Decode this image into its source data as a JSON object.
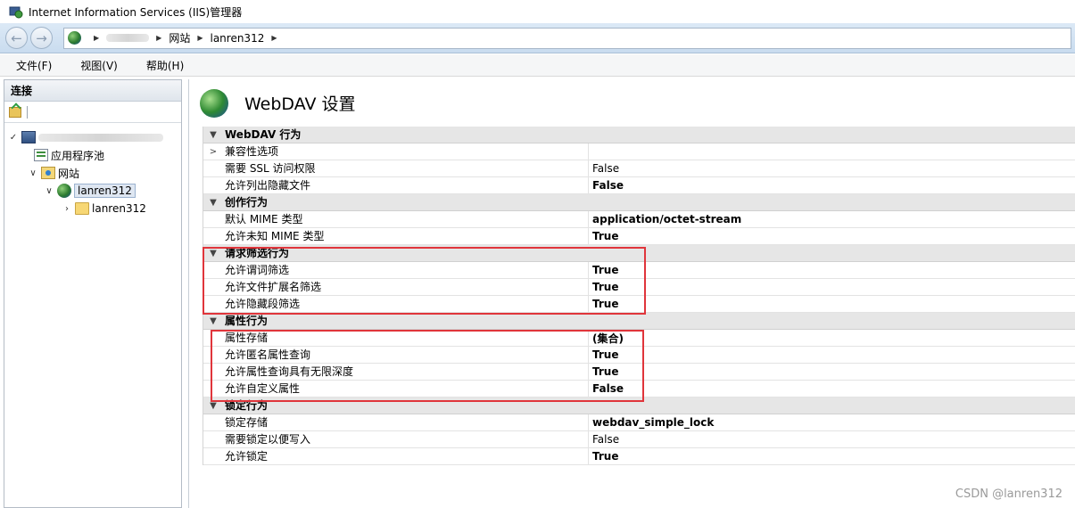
{
  "window": {
    "title": "Internet Information Services (IIS)管理器"
  },
  "address": {
    "crumbs": [
      "网站",
      "lanren312"
    ]
  },
  "menu": [
    "文件(F)",
    "视图(V)",
    "帮助(H)"
  ],
  "connections": {
    "header": "连接",
    "tree": {
      "app_pools": "应用程序池",
      "sites": "网站",
      "site": "lanren312",
      "folder": "lanren312"
    }
  },
  "page": {
    "title": "WebDAV 设置"
  },
  "properties": [
    {
      "type": "section",
      "label": "WebDAV 行为",
      "expander": "▼"
    },
    {
      "type": "row",
      "label": "兼容性选项",
      "value": "",
      "expander": ">"
    },
    {
      "type": "row",
      "label": "需要 SSL 访问权限",
      "value": "False",
      "bold": false
    },
    {
      "type": "row",
      "label": "允许列出隐藏文件",
      "value": "False",
      "bold": true
    },
    {
      "type": "section",
      "label": "创作行为",
      "expander": "▼"
    },
    {
      "type": "row",
      "label": "默认 MIME 类型",
      "value": "application/octet-stream",
      "bold": true
    },
    {
      "type": "row",
      "label": "允许未知 MIME 类型",
      "value": "True",
      "bold": true
    },
    {
      "type": "section",
      "label": "请求筛选行为",
      "expander": "▼"
    },
    {
      "type": "row",
      "label": "允许谓词筛选",
      "value": "True",
      "bold": true
    },
    {
      "type": "row",
      "label": "允许文件扩展名筛选",
      "value": "True",
      "bold": true
    },
    {
      "type": "row",
      "label": "允许隐藏段筛选",
      "value": "True",
      "bold": true
    },
    {
      "type": "section",
      "label": "属性行为",
      "expander": "▼"
    },
    {
      "type": "row",
      "label": "属性存储",
      "value": "(集合)",
      "bold": true
    },
    {
      "type": "row",
      "label": "允许匿名属性查询",
      "value": "True",
      "bold": true
    },
    {
      "type": "row",
      "label": "允许属性查询具有无限深度",
      "value": "True",
      "bold": true
    },
    {
      "type": "row",
      "label": "允许自定义属性",
      "value": "False",
      "bold": true
    },
    {
      "type": "section",
      "label": "锁定行为",
      "expander": "▼"
    },
    {
      "type": "row",
      "label": "锁定存储",
      "value": "webdav_simple_lock",
      "bold": true
    },
    {
      "type": "row",
      "label": "需要锁定以便写入",
      "value": "False",
      "bold": false
    },
    {
      "type": "row",
      "label": "允许锁定",
      "value": "True",
      "bold": true
    }
  ],
  "watermark": "CSDN @lanren312",
  "colors": {
    "highlight_box": "#e0353b",
    "section_bg": "#e6e6e6"
  }
}
